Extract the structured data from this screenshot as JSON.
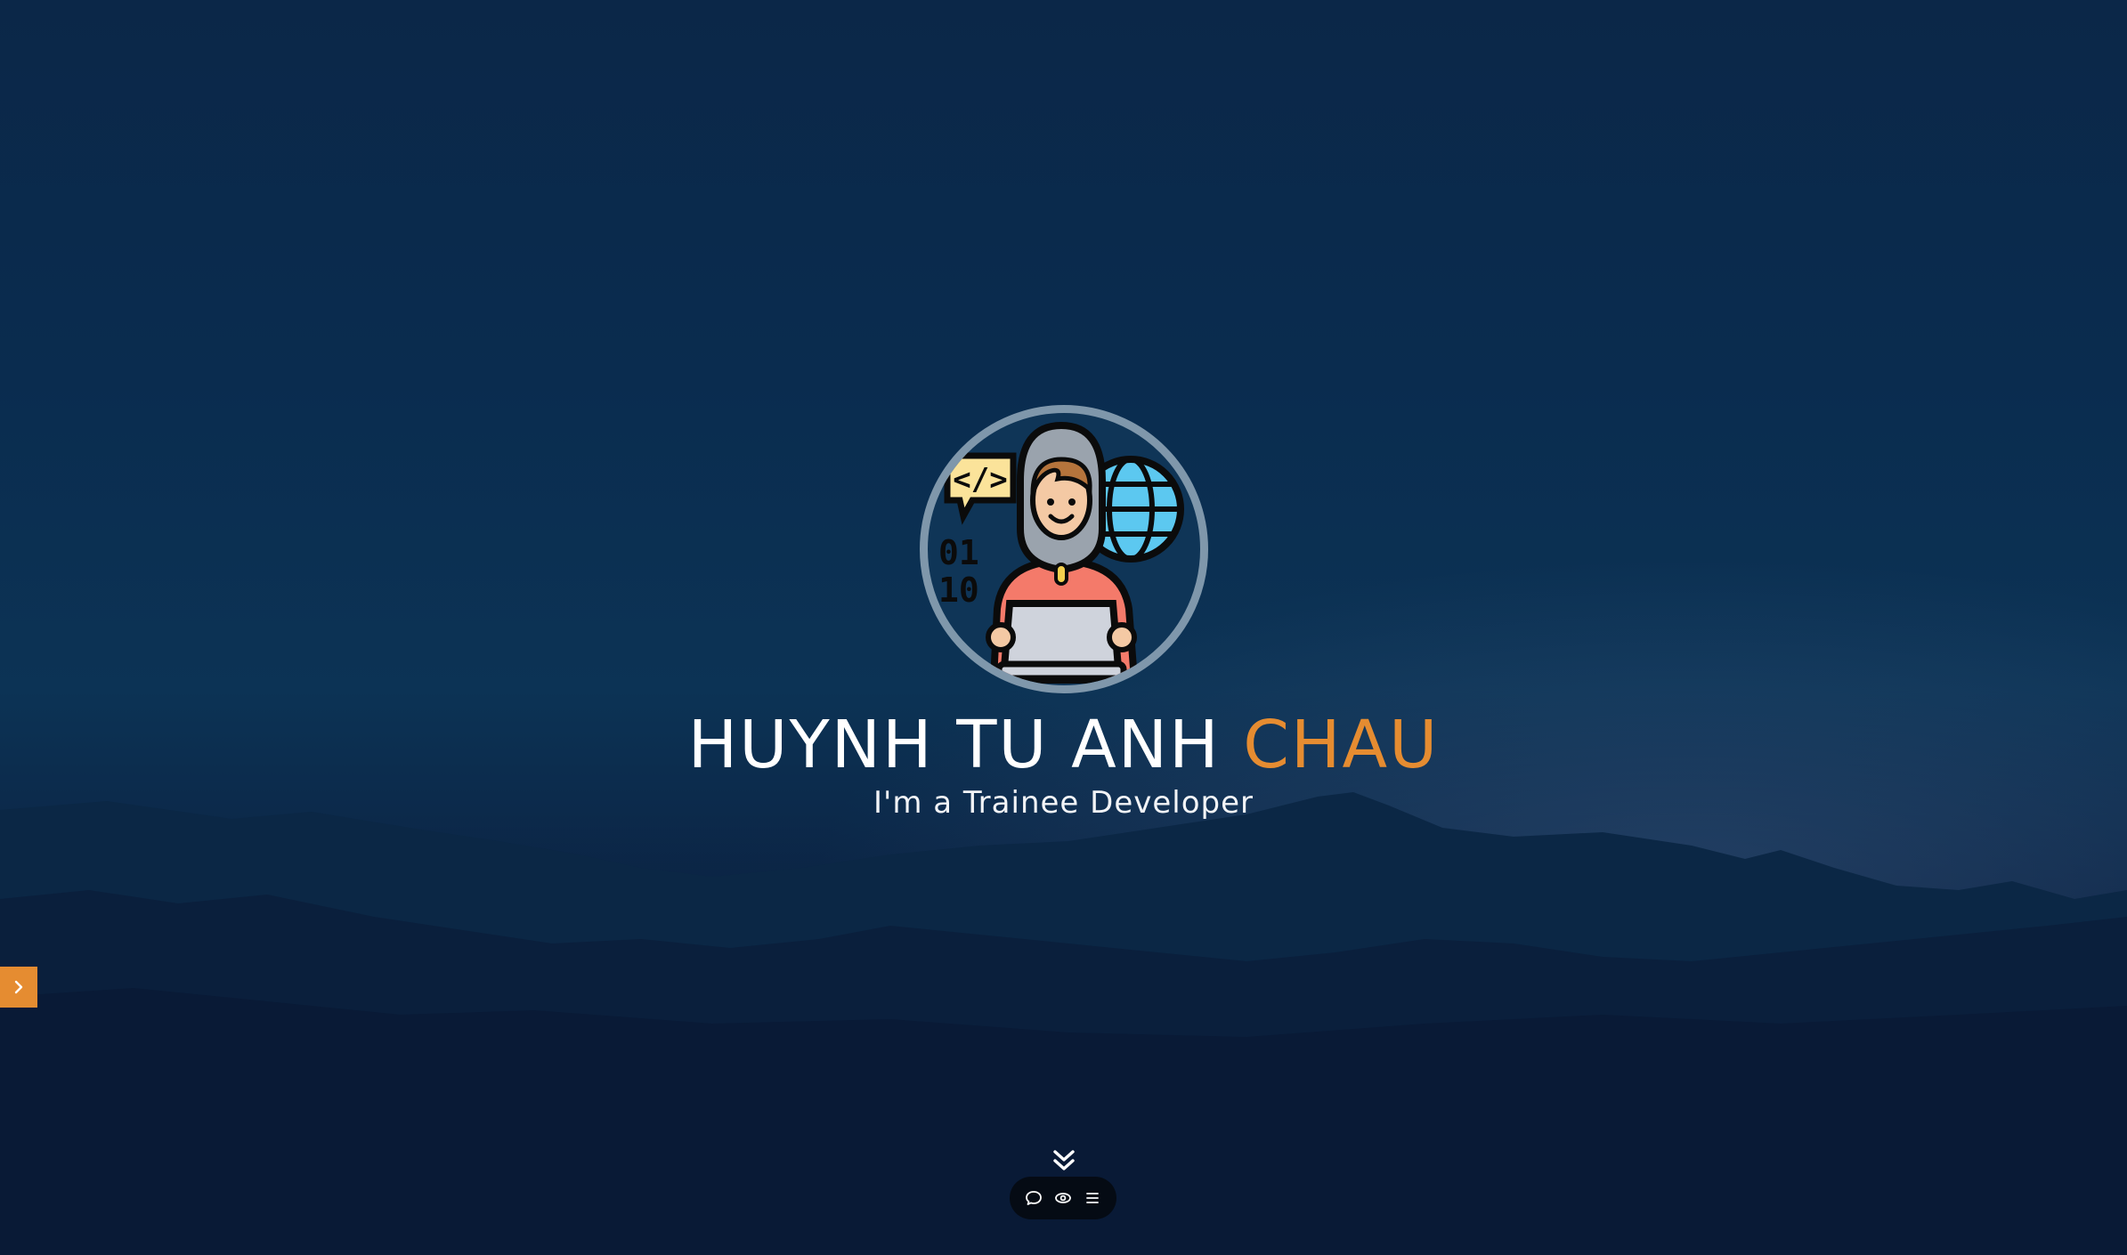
{
  "hero": {
    "name_main": "HUYNH TU ANH",
    "name_accent": "CHAU",
    "role": "I'm a Trainee Developer",
    "avatar_icon": "developer-avatar-icon",
    "avatar_code_text": "</>",
    "avatar_binary_text": [
      "01",
      "10"
    ]
  },
  "controls": {
    "side_toggle_icon": "chevron-right-icon",
    "scroll_down_icon": "double-chevron-down-icon",
    "bottom_bar": [
      {
        "icon": "chat-bubble-icon"
      },
      {
        "icon": "eye-icon"
      },
      {
        "icon": "menu-icon"
      }
    ]
  },
  "colors": {
    "accent": "#e58c31",
    "background": "#0b2748",
    "avatar_ring": "#7f97ab"
  }
}
